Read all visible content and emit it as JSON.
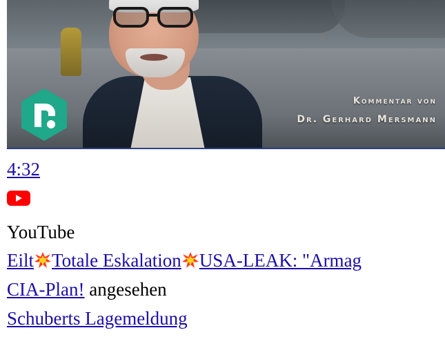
{
  "video": {
    "thumbnail": {
      "caption_line1": "Kommentar von",
      "caption_line2": "Dr. Gerhard Mersmann",
      "logo_letter": "r",
      "accent_color": "#2b3f86"
    },
    "duration": "4:32",
    "platform_icon": "youtube-icon",
    "platform_color": "#ff0000",
    "source": "YouTube",
    "title_part1": "Eilt",
    "title_part2": "Totale Eskalation",
    "title_part3": "USA-LEAK: \"Armag",
    "title_line2_link": "CIA-Plan!",
    "title_line2_rest": " angesehen",
    "emoji_icon": "collision-icon",
    "channel": "Schuberts Lagemeldung"
  }
}
